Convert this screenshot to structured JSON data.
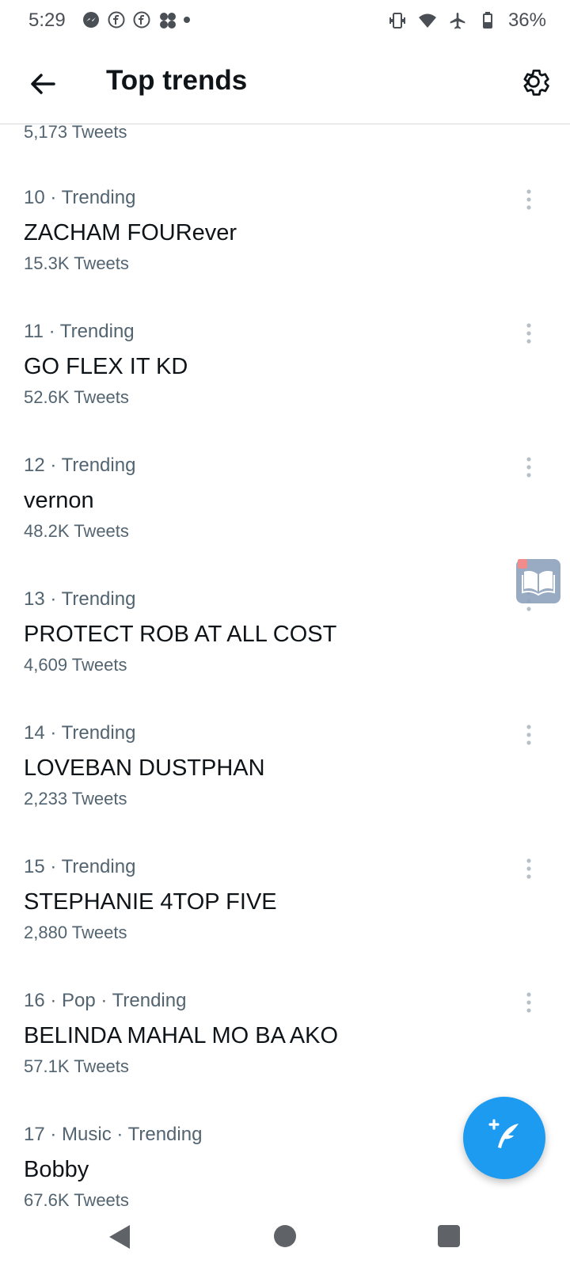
{
  "status_bar": {
    "time": "5:29",
    "battery": "36%",
    "notification_icons": [
      "messenger-icon",
      "facebook-icon",
      "facebook-icon",
      "pinwheel-icon",
      "dot-icon"
    ],
    "system_icons": [
      "vibrate-icon",
      "wifi-icon",
      "airplane-icon",
      "battery-icon"
    ]
  },
  "app_bar": {
    "title": "Top trends",
    "back_icon": "arrow-left-icon",
    "settings_icon": "gear-icon"
  },
  "partial_top_count": "5,173 Tweets",
  "trends": [
    {
      "meta": "10 · Trending",
      "name": "ZACHAM FOURever",
      "count": "15.3K Tweets"
    },
    {
      "meta": "11 · Trending",
      "name": "GO FLEX IT KD",
      "count": "52.6K Tweets"
    },
    {
      "meta": "12 · Trending",
      "name": "vernon",
      "count": "48.2K Tweets"
    },
    {
      "meta": "13 · Trending",
      "name": "PROTECT ROB AT ALL COST",
      "count": "4,609 Tweets"
    },
    {
      "meta": "14 · Trending",
      "name": "LOVEBAN DUSTPHAN",
      "count": "2,233 Tweets"
    },
    {
      "meta": "15 · Trending",
      "name": "STEPHANIE 4TOP FIVE",
      "count": "2,880 Tweets"
    },
    {
      "meta": "16 · Pop · Trending",
      "name": "BELINDA MAHAL MO BA AKO",
      "count": "57.1K Tweets"
    },
    {
      "meta": "17 · Music · Trending",
      "name": "Bobby",
      "count": "67.6K Tweets"
    }
  ],
  "fab": {
    "icon": "compose-tweet-icon"
  },
  "nav_bar": {
    "icons": [
      "back-triangle-icon",
      "home-circle-icon",
      "recents-square-icon"
    ]
  },
  "colors": {
    "accent": "#1d9bf0",
    "secondary_text": "#536471",
    "primary_text": "#0f1419"
  }
}
